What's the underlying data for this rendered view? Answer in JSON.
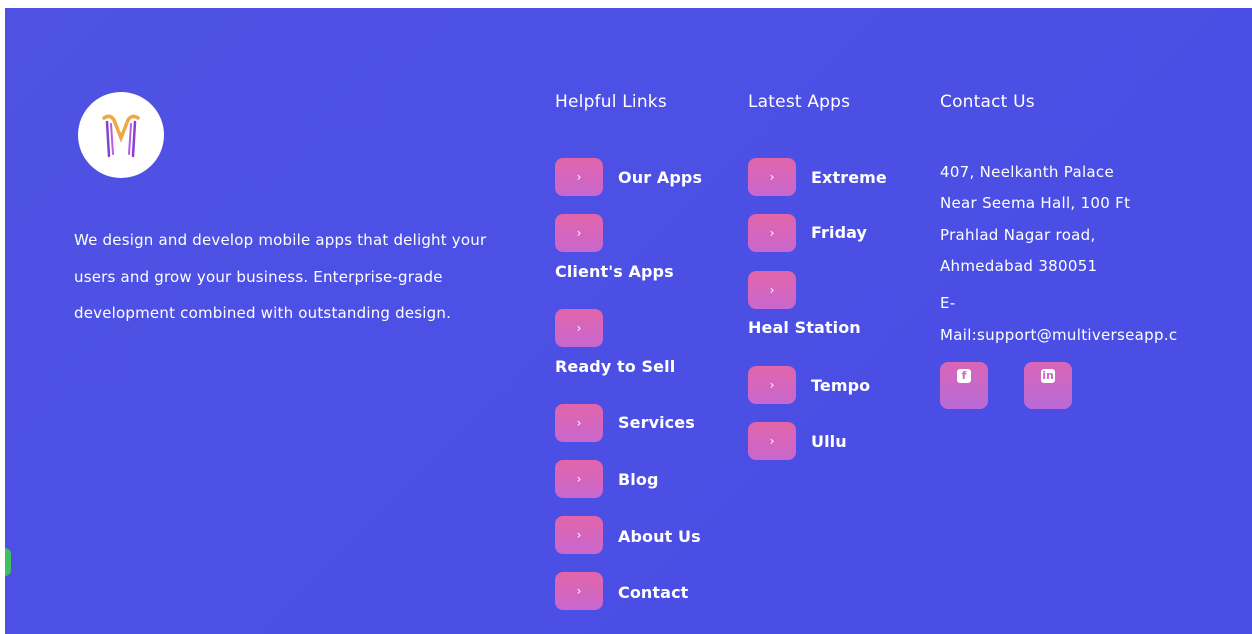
{
  "about": {
    "text": "We design and develop mobile apps that delight your users and grow your business. Enterprise-grade development combined with outstanding design."
  },
  "helpful_links": {
    "title": "Helpful Links",
    "items": [
      {
        "label": "Our Apps"
      },
      {
        "label": "Client's Apps"
      },
      {
        "label": "Ready to Sell"
      },
      {
        "label": "Services"
      },
      {
        "label": "Blog"
      },
      {
        "label": "About Us"
      },
      {
        "label": "Contact"
      }
    ]
  },
  "latest_apps": {
    "title": "Latest Apps",
    "items": [
      {
        "label": "Extreme"
      },
      {
        "label": "Friday"
      },
      {
        "label": "Heal Station"
      },
      {
        "label": "Tempo"
      },
      {
        "label": "Ullu"
      }
    ]
  },
  "contact": {
    "title": "Contact Us",
    "address_lines": [
      "407, Neelkanth Palace",
      "Near Seema Hall, 100 Ft",
      "Prahlad Nagar road,",
      "Ahmedabad 380051"
    ],
    "email_prefix": "E-",
    "email": "Mail:support@multiverseapp.c",
    "social": [
      {
        "name": "facebook",
        "glyph": "f"
      },
      {
        "name": "linkedin",
        "glyph": "in"
      }
    ]
  },
  "arrow_glyph": "›",
  "colors": {
    "background": "#4b4fe4",
    "button_gradient_top": "#e265a9",
    "button_gradient_bottom": "#c867cf",
    "text": "#ffffff",
    "logo_gold": "#f0a844",
    "logo_purple": "#8a3fd0"
  }
}
